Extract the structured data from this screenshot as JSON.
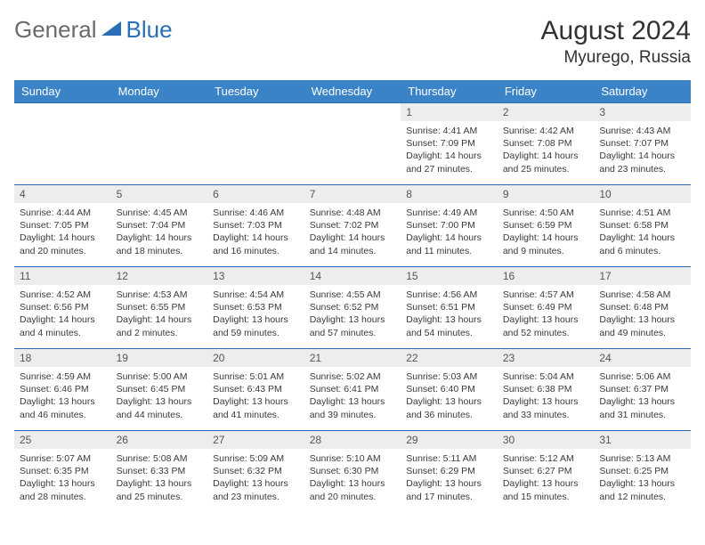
{
  "brand": {
    "part1": "General",
    "part2": "Blue"
  },
  "title": "August 2024",
  "location": "Myurego, Russia",
  "weekdays": [
    "Sunday",
    "Monday",
    "Tuesday",
    "Wednesday",
    "Thursday",
    "Friday",
    "Saturday"
  ],
  "startOffset": 4,
  "days": [
    {
      "n": "1",
      "sunrise": "4:41 AM",
      "sunset": "7:09 PM",
      "daylight": "14 hours and 27 minutes."
    },
    {
      "n": "2",
      "sunrise": "4:42 AM",
      "sunset": "7:08 PM",
      "daylight": "14 hours and 25 minutes."
    },
    {
      "n": "3",
      "sunrise": "4:43 AM",
      "sunset": "7:07 PM",
      "daylight": "14 hours and 23 minutes."
    },
    {
      "n": "4",
      "sunrise": "4:44 AM",
      "sunset": "7:05 PM",
      "daylight": "14 hours and 20 minutes."
    },
    {
      "n": "5",
      "sunrise": "4:45 AM",
      "sunset": "7:04 PM",
      "daylight": "14 hours and 18 minutes."
    },
    {
      "n": "6",
      "sunrise": "4:46 AM",
      "sunset": "7:03 PM",
      "daylight": "14 hours and 16 minutes."
    },
    {
      "n": "7",
      "sunrise": "4:48 AM",
      "sunset": "7:02 PM",
      "daylight": "14 hours and 14 minutes."
    },
    {
      "n": "8",
      "sunrise": "4:49 AM",
      "sunset": "7:00 PM",
      "daylight": "14 hours and 11 minutes."
    },
    {
      "n": "9",
      "sunrise": "4:50 AM",
      "sunset": "6:59 PM",
      "daylight": "14 hours and 9 minutes."
    },
    {
      "n": "10",
      "sunrise": "4:51 AM",
      "sunset": "6:58 PM",
      "daylight": "14 hours and 6 minutes."
    },
    {
      "n": "11",
      "sunrise": "4:52 AM",
      "sunset": "6:56 PM",
      "daylight": "14 hours and 4 minutes."
    },
    {
      "n": "12",
      "sunrise": "4:53 AM",
      "sunset": "6:55 PM",
      "daylight": "14 hours and 2 minutes."
    },
    {
      "n": "13",
      "sunrise": "4:54 AM",
      "sunset": "6:53 PM",
      "daylight": "13 hours and 59 minutes."
    },
    {
      "n": "14",
      "sunrise": "4:55 AM",
      "sunset": "6:52 PM",
      "daylight": "13 hours and 57 minutes."
    },
    {
      "n": "15",
      "sunrise": "4:56 AM",
      "sunset": "6:51 PM",
      "daylight": "13 hours and 54 minutes."
    },
    {
      "n": "16",
      "sunrise": "4:57 AM",
      "sunset": "6:49 PM",
      "daylight": "13 hours and 52 minutes."
    },
    {
      "n": "17",
      "sunrise": "4:58 AM",
      "sunset": "6:48 PM",
      "daylight": "13 hours and 49 minutes."
    },
    {
      "n": "18",
      "sunrise": "4:59 AM",
      "sunset": "6:46 PM",
      "daylight": "13 hours and 46 minutes."
    },
    {
      "n": "19",
      "sunrise": "5:00 AM",
      "sunset": "6:45 PM",
      "daylight": "13 hours and 44 minutes."
    },
    {
      "n": "20",
      "sunrise": "5:01 AM",
      "sunset": "6:43 PM",
      "daylight": "13 hours and 41 minutes."
    },
    {
      "n": "21",
      "sunrise": "5:02 AM",
      "sunset": "6:41 PM",
      "daylight": "13 hours and 39 minutes."
    },
    {
      "n": "22",
      "sunrise": "5:03 AM",
      "sunset": "6:40 PM",
      "daylight": "13 hours and 36 minutes."
    },
    {
      "n": "23",
      "sunrise": "5:04 AM",
      "sunset": "6:38 PM",
      "daylight": "13 hours and 33 minutes."
    },
    {
      "n": "24",
      "sunrise": "5:06 AM",
      "sunset": "6:37 PM",
      "daylight": "13 hours and 31 minutes."
    },
    {
      "n": "25",
      "sunrise": "5:07 AM",
      "sunset": "6:35 PM",
      "daylight": "13 hours and 28 minutes."
    },
    {
      "n": "26",
      "sunrise": "5:08 AM",
      "sunset": "6:33 PM",
      "daylight": "13 hours and 25 minutes."
    },
    {
      "n": "27",
      "sunrise": "5:09 AM",
      "sunset": "6:32 PM",
      "daylight": "13 hours and 23 minutes."
    },
    {
      "n": "28",
      "sunrise": "5:10 AM",
      "sunset": "6:30 PM",
      "daylight": "13 hours and 20 minutes."
    },
    {
      "n": "29",
      "sunrise": "5:11 AM",
      "sunset": "6:29 PM",
      "daylight": "13 hours and 17 minutes."
    },
    {
      "n": "30",
      "sunrise": "5:12 AM",
      "sunset": "6:27 PM",
      "daylight": "13 hours and 15 minutes."
    },
    {
      "n": "31",
      "sunrise": "5:13 AM",
      "sunset": "6:25 PM",
      "daylight": "13 hours and 12 minutes."
    }
  ],
  "labels": {
    "sunrise": "Sunrise: ",
    "sunset": "Sunset: ",
    "daylight": "Daylight: "
  }
}
